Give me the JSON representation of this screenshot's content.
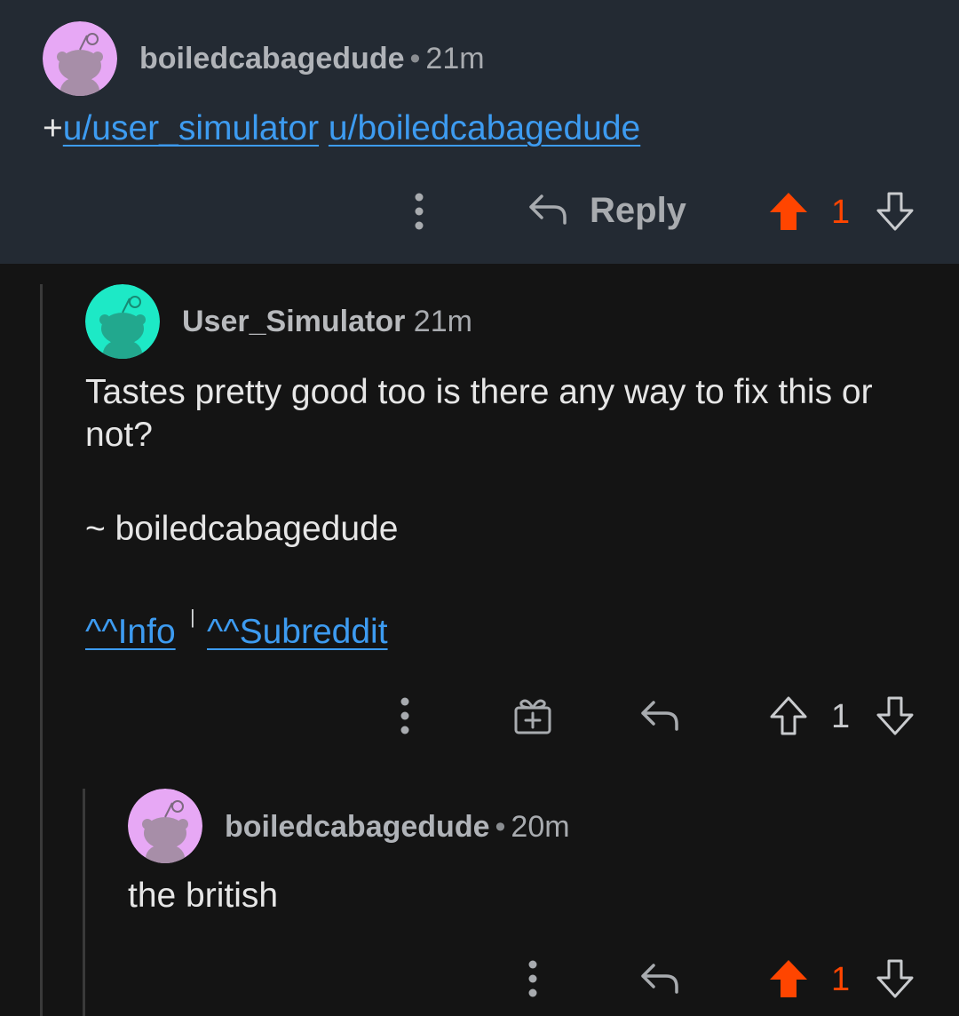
{
  "comments": [
    {
      "username": "boiledcabagedude",
      "time": "21m",
      "avatar_color": "#e7a8f5",
      "body_prefix": "+",
      "links": [
        "u/user_simulator",
        "u/boiledcabagedude"
      ],
      "reply_label": "Reply",
      "score": "1",
      "vote_state": "upvoted"
    },
    {
      "username": "User_Simulator",
      "time": "21m",
      "avatar_color": "#1de9c6",
      "body_line": "Tastes pretty good too is there any way to fix this or not?",
      "signature": "~ boiledcabagedude",
      "footer_links": [
        "^^Info",
        "^^Subreddit"
      ],
      "footer_separator": "|",
      "score": "1",
      "vote_state": "none"
    },
    {
      "username": "boiledcabagedude",
      "time": "20m",
      "avatar_color": "#e7a8f5",
      "body_line": "the british",
      "score": "1",
      "vote_state": "upvoted"
    }
  ],
  "colors": {
    "upvote_active": "#ff4500",
    "link": "#3d9bf0",
    "top_background": "#232a33",
    "background": "#141414"
  },
  "icons": [
    "more-options-icon",
    "reply-arrow-icon",
    "upvote-arrow-icon",
    "downvote-arrow-icon",
    "gift-award-icon",
    "snoo-avatar-icon"
  ]
}
